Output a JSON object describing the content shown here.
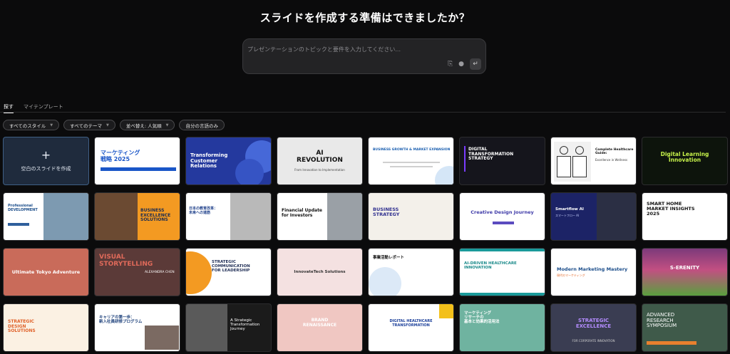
{
  "heading": "スライドを作成する準備はできましたか？",
  "prompt": {
    "placeholder": "プレゼンテーションのトピックと要件を入力してください..."
  },
  "tabs": [
    {
      "label": "探す"
    },
    {
      "label": "マイテンプレート"
    }
  ],
  "filters": [
    {
      "label": "すべてのスタイル"
    },
    {
      "label": "すべてのテーマ"
    },
    {
      "label": "並べ替え: 人気順"
    },
    {
      "label": "自分の言語のみ"
    }
  ],
  "blank_card": {
    "label": "空白のスライドを作成"
  },
  "templates": [
    {
      "title": "マーケティング\n戦略 2025"
    },
    {
      "title": "Transforming\nCustomer\nRelations"
    },
    {
      "title": "AI\nREVOLUTION",
      "subtitle": "From Innovation to Implementation"
    },
    {
      "title": "BUSINESS GROWTH & MARKET EXPANSION"
    },
    {
      "title": "DIGITAL\nTRANSFORMATION\nSTRATEGY"
    },
    {
      "title": "Complete Healthcare\nGuide:",
      "subtitle": "Excellence in Wellness"
    },
    {
      "title": "Digital Learning\nInnovation"
    },
    {
      "title": "Professional\nDEVELOPMENT"
    },
    {
      "title": "BUSINESS\nEXCELLENCE\nSOLUTIONS"
    },
    {
      "title": "日本の教育改革：\n未来への道筋"
    },
    {
      "title": "Financial Update\nfor Investors"
    },
    {
      "title": "BUSINESS\nSTRATEGY"
    },
    {
      "title": "Creative Design Journey"
    },
    {
      "title": "Smartflow AI",
      "subtitle": "スマートフロー AI"
    },
    {
      "title": "SMART HOME\nMARKET INSIGHTS\n2025"
    },
    {
      "title": "Ultimate Tokyo Adventure"
    },
    {
      "title": "VISUAL\nSTORYTELLING",
      "subtitle": "ALEXANDRA CHEN"
    },
    {
      "title": "STRATEGIC\nCOMMUNICATION\nFOR LEADERSHIP"
    },
    {
      "title": "InnovateTech Solutions"
    },
    {
      "title": "事業活動レポート"
    },
    {
      "title": "AI-DRIVEN HEALTHCARE\nINNOVATION"
    },
    {
      "title": "Modern Marketing Mastery",
      "subtitle": "現代のマーケティング"
    },
    {
      "title": "S-ERENITY"
    },
    {
      "title": "STRATEGIC\nDESIGN\nSOLUTIONS"
    },
    {
      "title": "キャリアの第一歩：\n新入社員研修プログラム"
    },
    {
      "title": "A Strategic\nTransformation\nJourney"
    },
    {
      "title": "BRAND\nRENAISSANCE"
    },
    {
      "title": "DIGITAL HEALTHCARE\nTRANSFORMATION"
    },
    {
      "title": "マーケティング\nリサーチの\n基本と効果的活用法"
    },
    {
      "title": "STRATEGIC\nEXCELLENCE",
      "subtitle": "FOR CORPORATE INNOVATION"
    },
    {
      "title": "ADVANCED\nRESEARCH\nSYMPOSIUM"
    }
  ]
}
